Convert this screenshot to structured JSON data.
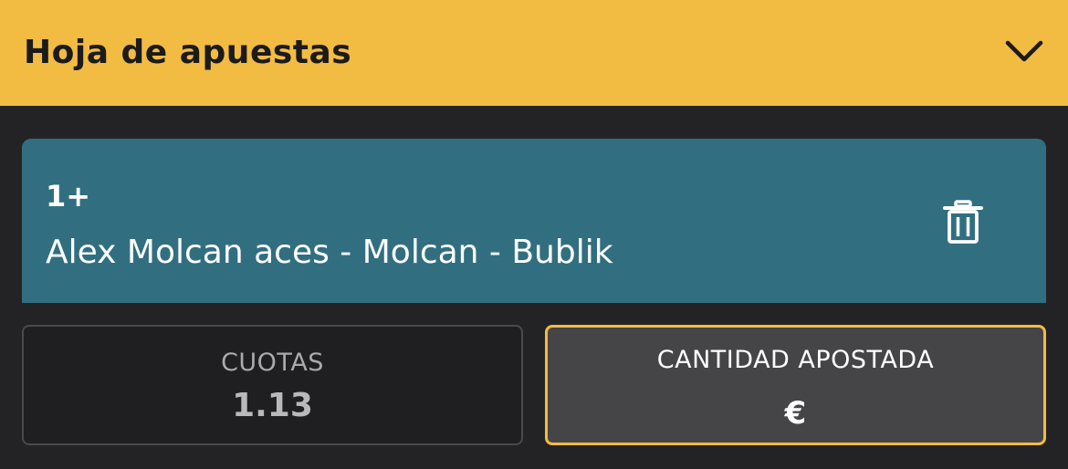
{
  "header": {
    "title": "Hoja de apuestas",
    "collapse_icon": "chevron-down-icon",
    "background": "#f2bb42"
  },
  "bet": {
    "selection": "1+",
    "market": "Alex Molcan aces - Molcan - Bublik",
    "delete_icon": "trash-icon",
    "card_color": "#316f80"
  },
  "odds": {
    "label": "CUOTAS",
    "value": "1.13"
  },
  "stake": {
    "label": "CANTIDAD APOSTADA",
    "currency": "€",
    "accent": "#f2bb42"
  }
}
